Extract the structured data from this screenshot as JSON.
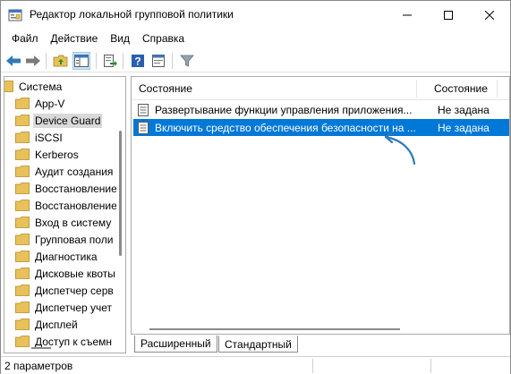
{
  "window": {
    "title": "Редактор локальной групповой политики"
  },
  "menu": [
    {
      "label": "Файл"
    },
    {
      "label": "Действие"
    },
    {
      "label": "Вид"
    },
    {
      "label": "Справка"
    }
  ],
  "tree": {
    "items": [
      {
        "label": "Система"
      },
      {
        "label": "App-V"
      },
      {
        "label": "Device Guard"
      },
      {
        "label": "iSCSI"
      },
      {
        "label": "Kerberos"
      },
      {
        "label": "Аудит создания"
      },
      {
        "label": "Восстановление"
      },
      {
        "label": "Восстановление"
      },
      {
        "label": "Вход в систему"
      },
      {
        "label": "Групповая поли"
      },
      {
        "label": "Диагностика"
      },
      {
        "label": "Дисковые квоты"
      },
      {
        "label": "Диспетчер серв"
      },
      {
        "label": "Диспетчер учет"
      },
      {
        "label": "Дисплей"
      },
      {
        "label": "Доступ к съемн"
      }
    ],
    "selected_label": "Device Guard"
  },
  "list": {
    "columns": [
      {
        "label": "Состояние"
      },
      {
        "label": "Состояние"
      }
    ],
    "rows": [
      {
        "name": "Развертывание функции управления приложения...",
        "state": "Не задана",
        "selected": false
      },
      {
        "name": "Включить средство обеспечения безопасности на ...",
        "state": "Не задана",
        "selected": true
      }
    ]
  },
  "tabs": [
    {
      "label": "Расширенный",
      "active": false
    },
    {
      "label": "Стандартный",
      "active": true
    }
  ],
  "status": {
    "text": "2 параметров"
  },
  "colors": {
    "selection": "#0078d7",
    "folder": "#e8c15a",
    "arrow": "#2f7ab8"
  },
  "icons": {
    "back": "arrow-left-icon",
    "forward": "arrow-right-icon",
    "up": "folder-up-icon",
    "show_hide_tree": "console-tree-icon",
    "export": "export-list-icon",
    "help": "help-icon",
    "properties": "properties-icon",
    "filter": "filter-icon"
  }
}
